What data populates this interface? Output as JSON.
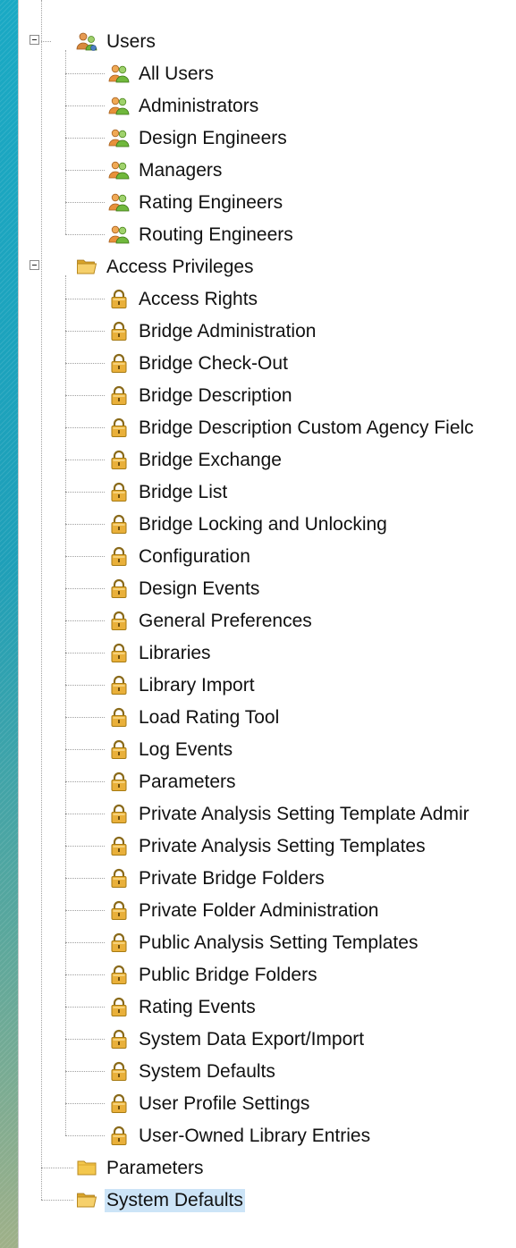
{
  "tree": {
    "users": {
      "label": "Users",
      "children": [
        "All Users",
        "Administrators",
        "Design Engineers",
        "Managers",
        "Rating Engineers",
        "Routing Engineers"
      ]
    },
    "access": {
      "label": "Access Privileges",
      "children": [
        "Access Rights",
        "Bridge Administration",
        "Bridge Check-Out",
        "Bridge Description",
        "Bridge Description Custom Agency Fielc",
        "Bridge Exchange",
        "Bridge List",
        "Bridge Locking and Unlocking",
        "Configuration",
        "Design Events",
        "General Preferences",
        "Libraries",
        "Library Import",
        "Load Rating Tool",
        "Log Events",
        "Parameters",
        "Private Analysis Setting Template Admir",
        "Private Analysis Setting Templates",
        "Private Bridge Folders",
        "Private Folder Administration",
        "Public Analysis Setting Templates",
        "Public Bridge Folders",
        "Rating Events",
        "System Data Export/Import",
        "System Defaults",
        "User Profile Settings",
        "User-Owned Library Entries"
      ]
    },
    "parameters": {
      "label": "Parameters"
    },
    "system_defaults": {
      "label": "System Defaults",
      "selected": true
    }
  },
  "icons": {
    "group": "users-group-icon",
    "user": "users-icon",
    "lock": "lock-icon",
    "folder_closed": "folder-icon",
    "folder_open": "folder-open-icon"
  },
  "colors": {
    "selection": "#cce4f7",
    "lock_gold": "#e9b03a",
    "folder": "#f3c74d"
  }
}
